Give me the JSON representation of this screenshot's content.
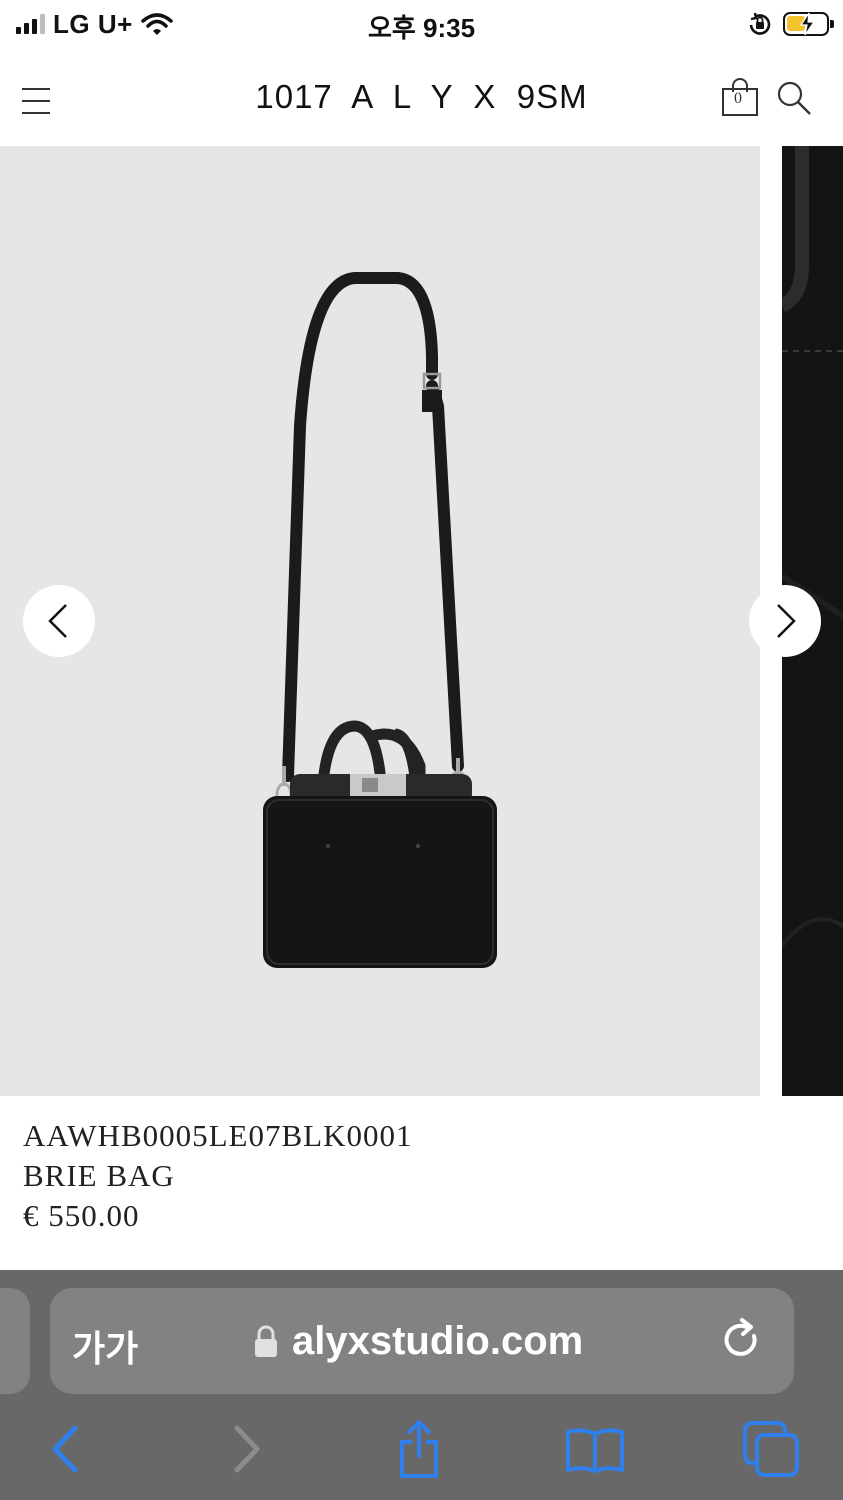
{
  "status_bar": {
    "carrier": "LG U+",
    "time": "오후 9:35",
    "icons": [
      "signal-icon",
      "wifi-icon",
      "orientation-lock-icon",
      "battery-charging-icon"
    ]
  },
  "header": {
    "logo": "1017  A  L  Y  X  9SM",
    "cart_count": "0",
    "icons": [
      "menu-icon",
      "shopping-bag-icon",
      "search-icon"
    ]
  },
  "gallery": {
    "image_subject": "black leather handbag with shoulder strap",
    "prev_icon": "chevron-left-icon",
    "next_icon": "chevron-right-icon",
    "background_color": "#e6e6e6"
  },
  "product": {
    "sku": "AAWHB0005LE07BLK0001",
    "name": "BRIE BAG",
    "price": "€ 550.00"
  },
  "browser": {
    "text_size_label": "가가",
    "url": "alyxstudio.com",
    "accent_color": "#2f80ed",
    "toolbar_icons": [
      "back-icon",
      "forward-icon",
      "share-icon",
      "bookmarks-icon",
      "tabs-icon"
    ]
  }
}
